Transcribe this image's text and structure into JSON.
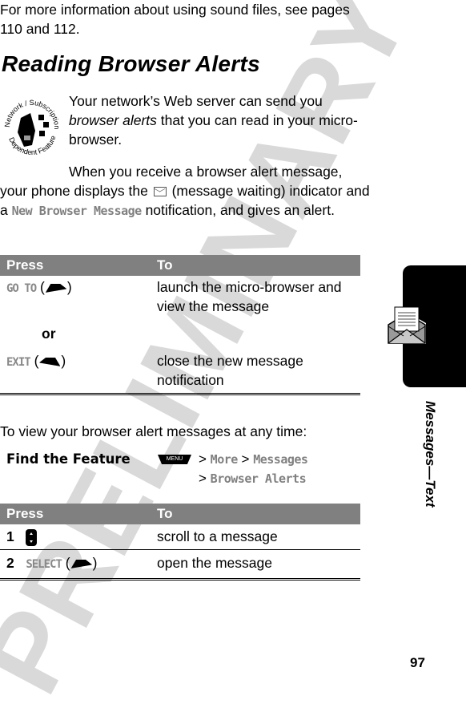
{
  "watermark": "PRELIMINARY",
  "intro_text": "For more information about using sound files, see pages 110 and 112.",
  "section_title": "Reading Browser Alerts",
  "badge": {
    "icon": "network-subscription-dependent-feature-icon",
    "top_text": "Network / Subscription",
    "bottom_text": "Dependent Feature"
  },
  "para1": {
    "before": "Your network’s Web server can send you ",
    "emphasis": "browser alerts",
    "after": " that you can read in your micro-browser."
  },
  "para2": {
    "before": "When you receive a browser alert message, your phone displays the ",
    "icon": "message-waiting-icon",
    "middle": " (message waiting) indicator and a ",
    "display_text": "New Browser Message",
    "after": " notification, and gives an alert."
  },
  "table1": {
    "headers": [
      "Press",
      "To"
    ],
    "rows": [
      {
        "key": "GO TO",
        "softkey": "right-soft-key-icon",
        "action": "launch the micro-browser and view the message"
      },
      {
        "separator": "or"
      },
      {
        "key": "EXIT",
        "softkey": "left-soft-key-icon",
        "action": "close the new message notification"
      }
    ]
  },
  "to_view_text": "To view your browser alert messages at any time:",
  "find_feature": {
    "label": "Find the Feature",
    "menu_key": "MENU",
    "path": [
      "More",
      "Messages",
      "Browser Alerts"
    ],
    "separator": ">"
  },
  "table2": {
    "headers": [
      "Press",
      "To"
    ],
    "rows": [
      {
        "step": "1",
        "key": "",
        "icon": "scroll-key-icon",
        "action": "scroll to a message"
      },
      {
        "step": "2",
        "key": "SELECT",
        "softkey": "right-soft-key-icon",
        "action": "open the message"
      }
    ]
  },
  "side_tab": {
    "icon": "message-envelope-icon",
    "title": "Messages—Text"
  },
  "page_number": "97"
}
